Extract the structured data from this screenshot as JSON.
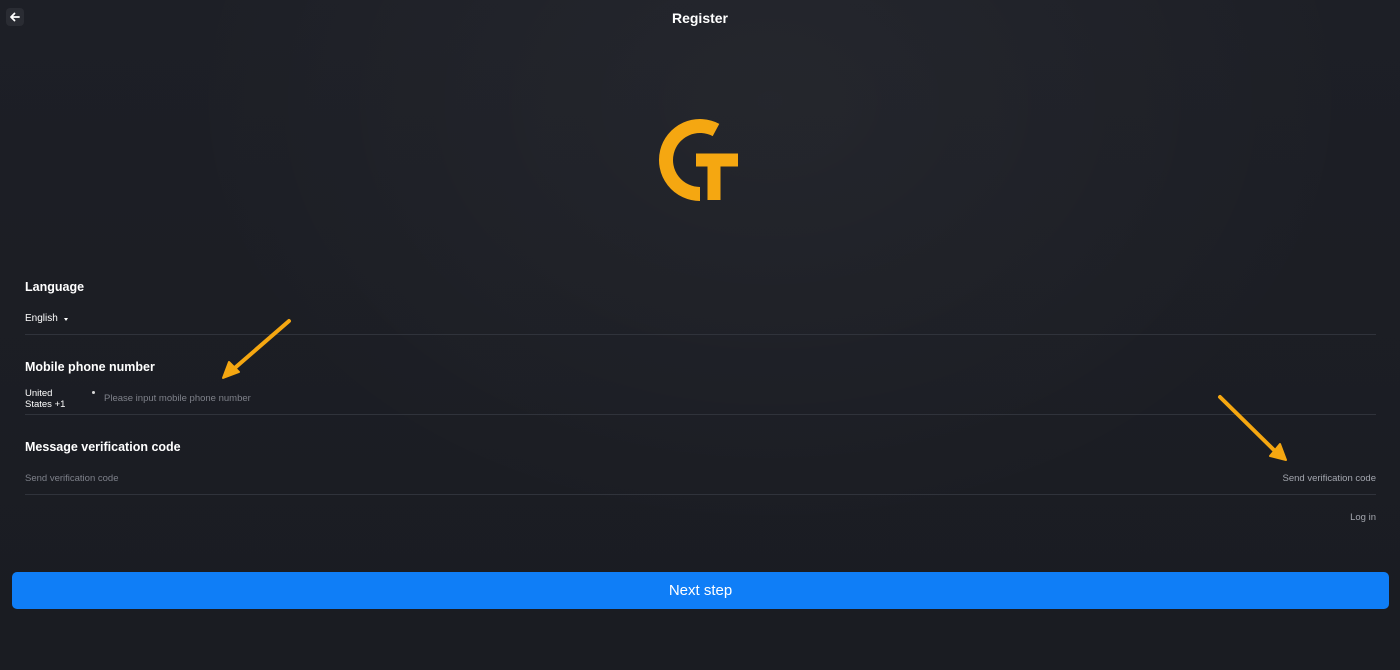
{
  "header": {
    "title": "Register",
    "back_icon": "arrow-left-icon"
  },
  "logo": {
    "icon": "gt-logo-icon",
    "color": "#f5a711"
  },
  "form": {
    "language": {
      "label": "Language",
      "value": "English"
    },
    "phone": {
      "label": "Mobile phone number",
      "country": "United States +1",
      "placeholder": "Please input mobile phone number",
      "value": ""
    },
    "verification": {
      "label": "Message verification code",
      "placeholder": "Send verification code",
      "value": "",
      "send_label": "Send verification code"
    },
    "login_label": "Log in"
  },
  "actions": {
    "next_label": "Next step",
    "accent_color": "#0f7ef7"
  },
  "annotations": {
    "arrow_color": "#f5a711"
  }
}
